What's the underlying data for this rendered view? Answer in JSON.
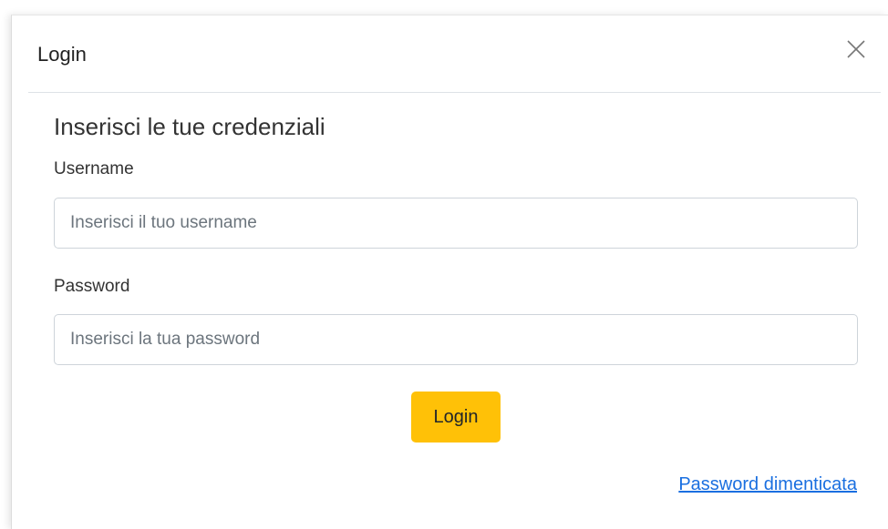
{
  "modal": {
    "title": "Login",
    "close_icon": "close-icon"
  },
  "form": {
    "subtitle": "Inserisci le tue credenziali",
    "username": {
      "label": "Username",
      "placeholder": "Inserisci il tuo username",
      "value": ""
    },
    "password": {
      "label": "Password",
      "placeholder": "Inserisci la tua password",
      "value": ""
    },
    "submit_label": "Login",
    "forgot_password_label": "Password dimenticata"
  },
  "colors": {
    "primary_button": "#ffc107",
    "link": "#1a6fe0"
  }
}
